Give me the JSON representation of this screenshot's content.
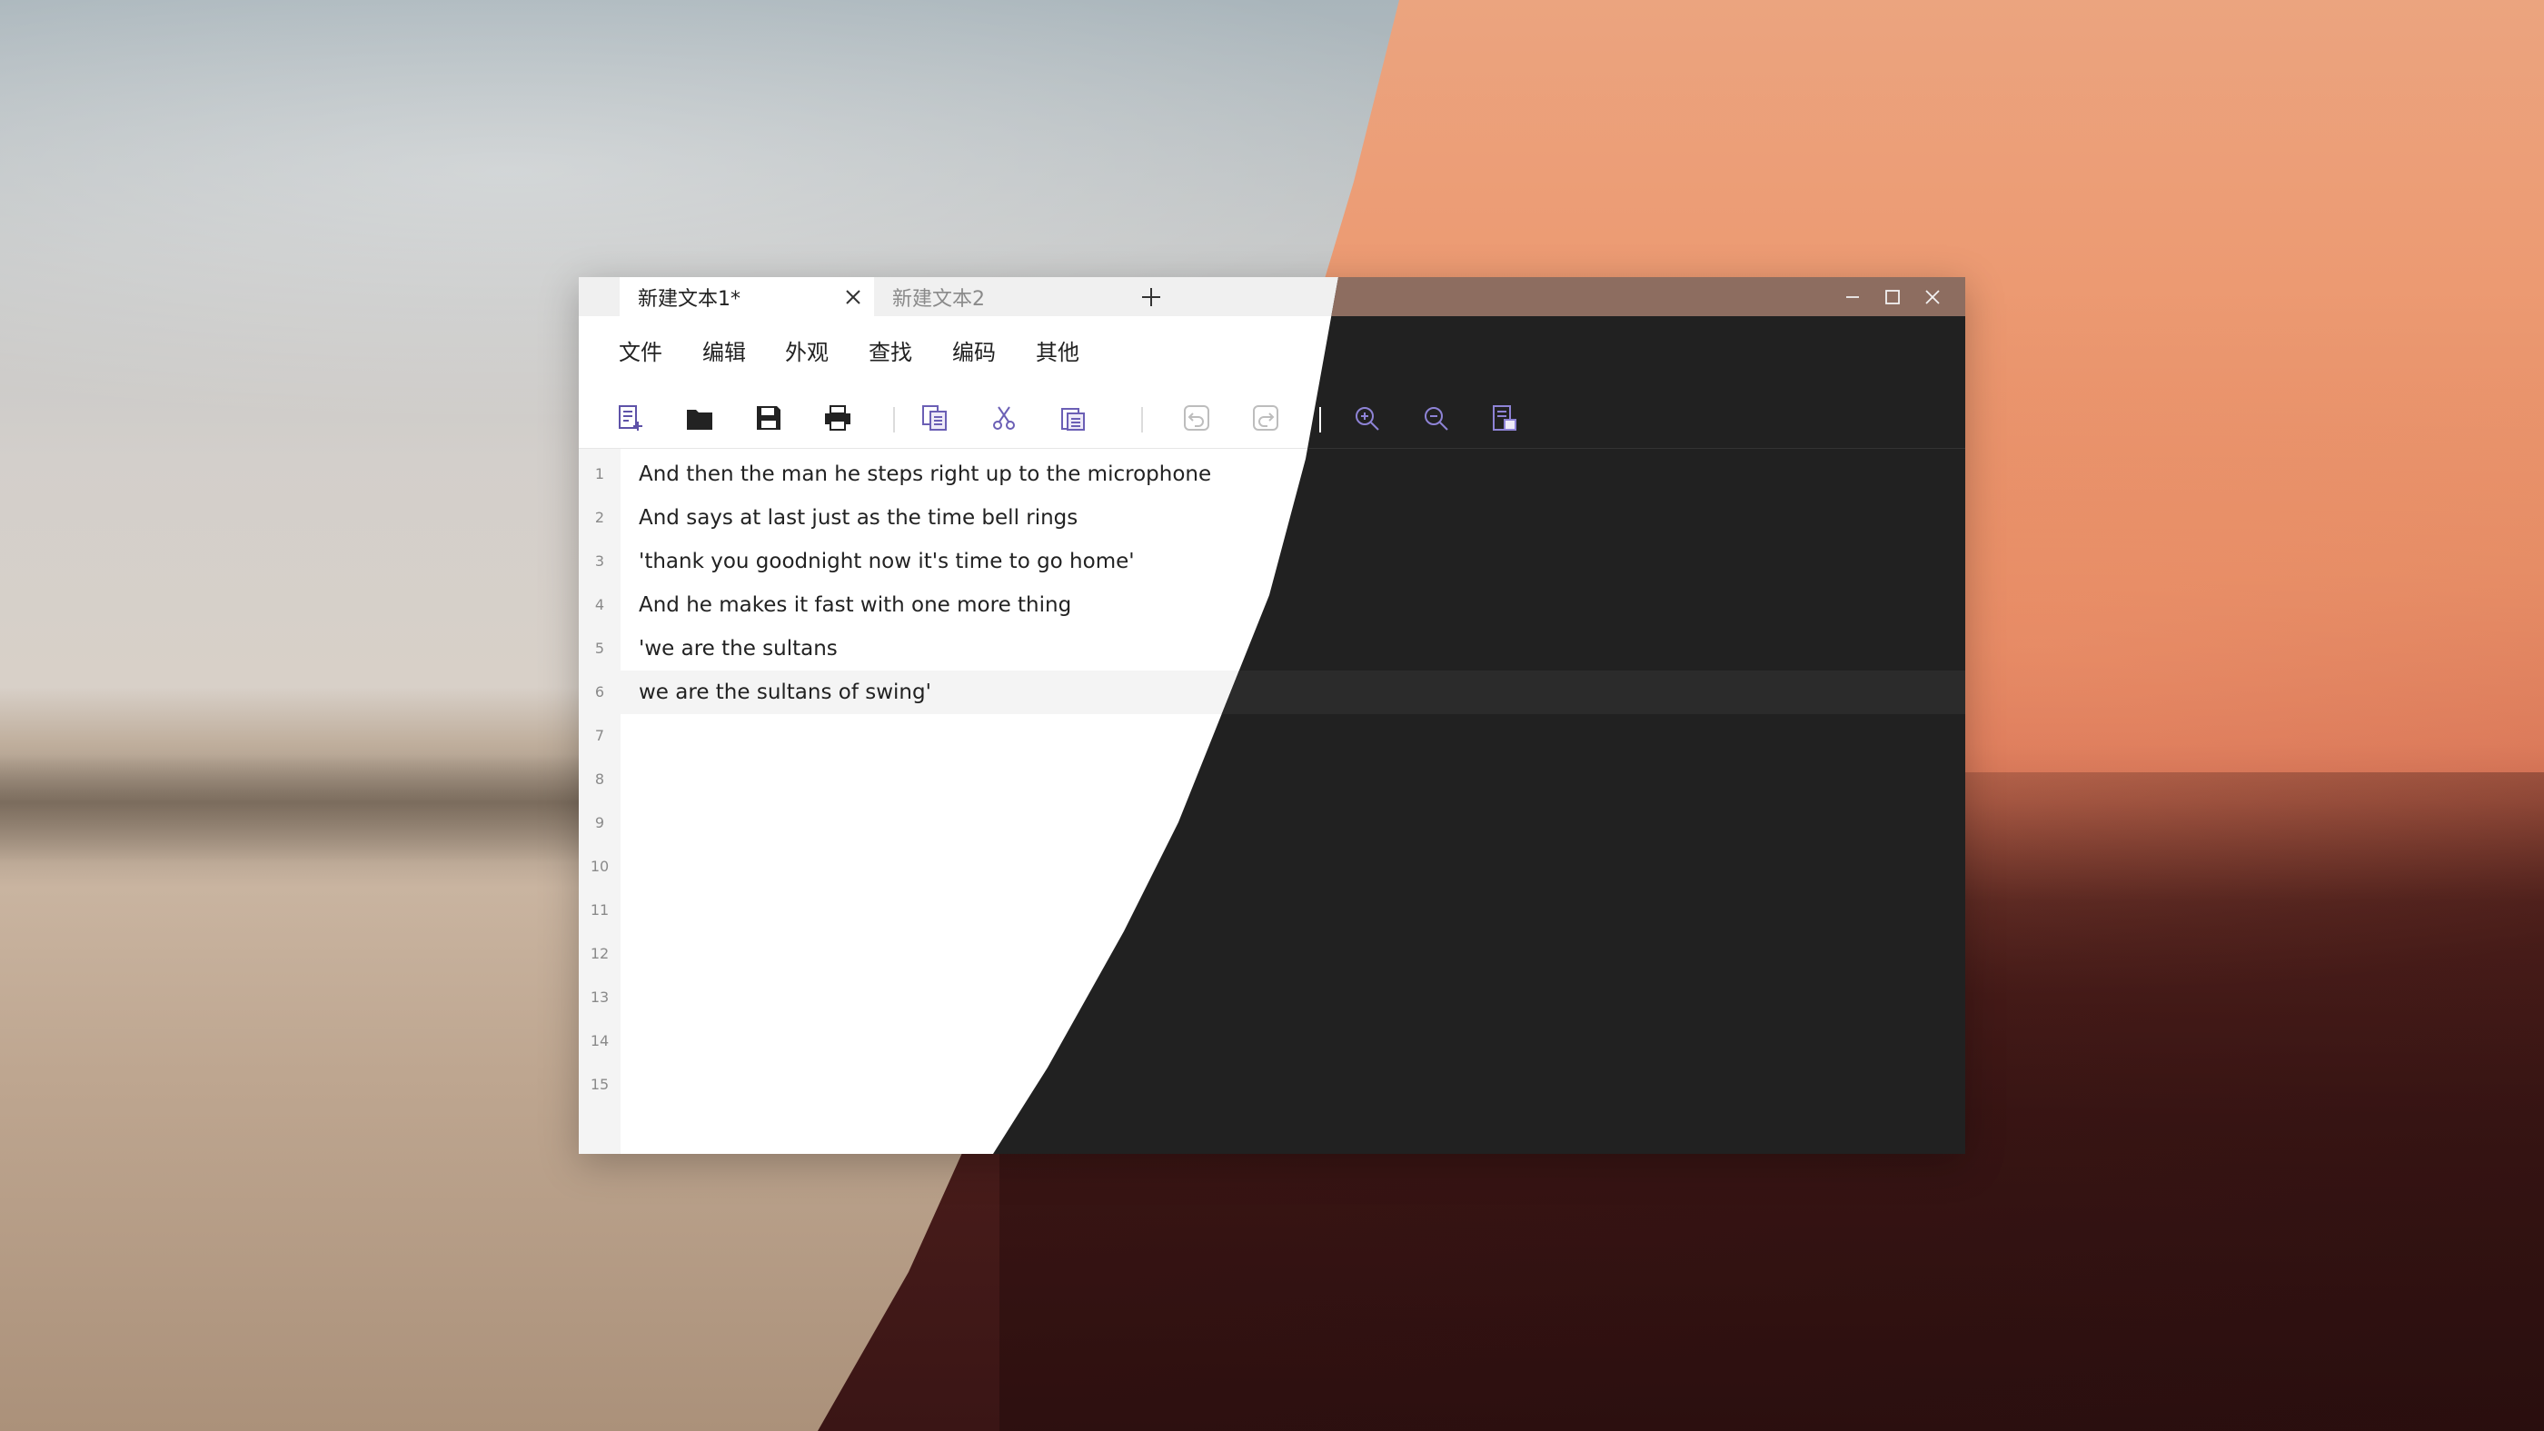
{
  "window": {
    "tabs": [
      {
        "label": "新建文本1*",
        "active": true
      },
      {
        "label": "新建文本2",
        "active": false
      }
    ]
  },
  "menu": {
    "items": [
      "文件",
      "编辑",
      "外观",
      "查找",
      "编码",
      "其他"
    ]
  },
  "toolbar": {
    "buttons": [
      {
        "icon": "new-file-icon"
      },
      {
        "icon": "open-folder-icon"
      },
      {
        "icon": "save-icon"
      },
      {
        "icon": "print-icon"
      },
      {
        "icon": "copy-icon"
      },
      {
        "icon": "cut-icon"
      },
      {
        "icon": "paste-icon"
      },
      {
        "icon": "undo-icon"
      },
      {
        "icon": "redo-icon"
      },
      {
        "icon": "zoom-in-icon"
      },
      {
        "icon": "zoom-out-icon"
      },
      {
        "icon": "document-view-icon"
      }
    ]
  },
  "editor": {
    "current_line": 6,
    "lines": [
      {
        "num": "1",
        "text": "And then the man he steps right up to the microphone"
      },
      {
        "num": "2",
        "text": "And says at last just as the time bell rings"
      },
      {
        "num": "3",
        "text": "'thank you goodnight now it's time to go home'"
      },
      {
        "num": "4",
        "text": "And he makes it fast with one more thing"
      },
      {
        "num": "5",
        "text": "'we are the sultans"
      },
      {
        "num": "6",
        "text": "we are the sultans of swing'"
      },
      {
        "num": "7",
        "text": ""
      },
      {
        "num": "8",
        "text": ""
      },
      {
        "num": "9",
        "text": ""
      },
      {
        "num": "10",
        "text": ""
      },
      {
        "num": "11",
        "text": ""
      },
      {
        "num": "12",
        "text": ""
      },
      {
        "num": "13",
        "text": ""
      },
      {
        "num": "14",
        "text": ""
      },
      {
        "num": "15",
        "text": ""
      }
    ]
  },
  "colors": {
    "accent": "#6b5fb5",
    "dark_background": "#212121",
    "dark_titlebar": "#8d6d60"
  }
}
